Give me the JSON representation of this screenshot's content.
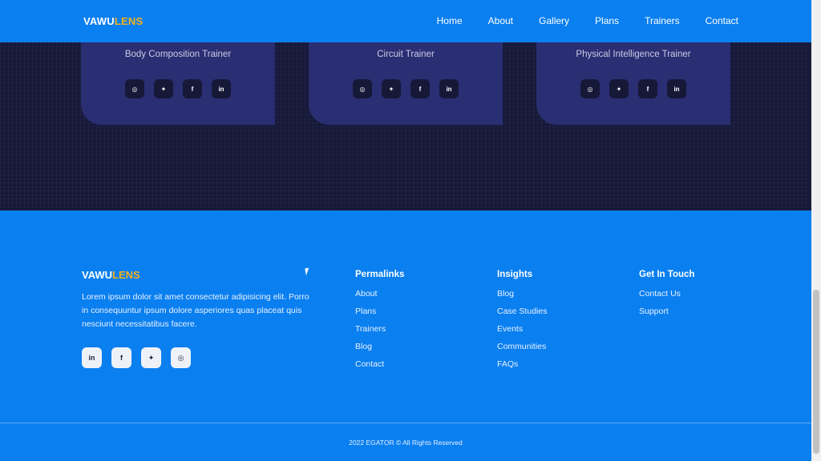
{
  "brand": {
    "part1": "VAWU",
    "part2": "LENS",
    "color_primary": "#0a7ff0",
    "color_accent": "#f5b21a"
  },
  "nav": {
    "items": [
      "Home",
      "About",
      "Gallery",
      "Plans",
      "Trainers",
      "Contact"
    ],
    "active": "Trainers"
  },
  "trainers": {
    "cards": [
      {
        "title": "Body Composition Trainer"
      },
      {
        "title": "Circuit Trainer"
      },
      {
        "title": "Physical Intelligence Trainer"
      }
    ],
    "social_icons": [
      "instagram-icon",
      "twitter-icon",
      "facebook-icon",
      "linkedin-icon"
    ]
  },
  "footer": {
    "description": "Lorem ipsum dolor sit amet consectetur adipisicing elit. Porro in consequuntur ipsum dolore asperiores quas placeat quis nesciunt necessitatibus facere.",
    "social_icons": [
      "linkedin-icon",
      "facebook-icon",
      "twitter-icon",
      "instagram-icon"
    ],
    "columns": [
      {
        "heading": "Permalinks",
        "links": [
          "About",
          "Plans",
          "Trainers",
          "Blog",
          "Contact"
        ]
      },
      {
        "heading": "Insights",
        "links": [
          "Blog",
          "Case Studies",
          "Events",
          "Communities",
          "FAQs"
        ]
      },
      {
        "heading": "Get In Touch",
        "links": [
          "Contact Us",
          "Support"
        ]
      }
    ],
    "copyright": "2022 EGATOR © All Rights Reserved"
  }
}
